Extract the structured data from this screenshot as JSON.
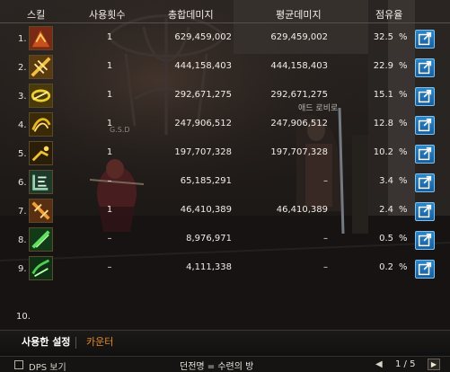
{
  "header": {
    "skill": "스킬",
    "uses": "사용횟수",
    "total": "총합데미지",
    "avg": "평균데미지",
    "share": "점유율"
  },
  "rows": [
    {
      "index": "1.",
      "icon": "skill-icon-1",
      "uses": "1",
      "total": "629,459,002",
      "avg": "629,459,002",
      "share": "32.5",
      "pct": "%"
    },
    {
      "index": "2.",
      "icon": "skill-icon-2",
      "uses": "1",
      "total": "444,158,403",
      "avg": "444,158,403",
      "share": "22.9",
      "pct": "%"
    },
    {
      "index": "3.",
      "icon": "skill-icon-3",
      "uses": "1",
      "total": "292,671,275",
      "avg": "292,671,275",
      "share": "15.1",
      "pct": "%"
    },
    {
      "index": "4.",
      "icon": "skill-icon-4",
      "uses": "1",
      "total": "247,906,512",
      "avg": "247,906,512",
      "share": "12.8",
      "pct": "%"
    },
    {
      "index": "5.",
      "icon": "skill-icon-5",
      "uses": "1",
      "total": "197,707,328",
      "avg": "197,707,328",
      "share": "10.2",
      "pct": "%"
    },
    {
      "index": "6.",
      "icon": "skill-icon-6",
      "uses": "–",
      "total": "65,185,291",
      "avg": "–",
      "share": "3.4",
      "pct": "%"
    },
    {
      "index": "7.",
      "icon": "skill-icon-7",
      "uses": "1",
      "total": "46,410,389",
      "avg": "46,410,389",
      "share": "2.4",
      "pct": "%"
    },
    {
      "index": "8.",
      "icon": "skill-icon-8",
      "uses": "–",
      "total": "8,976,971",
      "avg": "–",
      "share": "0.5",
      "pct": "%"
    },
    {
      "index": "9.",
      "icon": "skill-icon-9",
      "uses": "–",
      "total": "4,111,338",
      "avg": "–",
      "share": "0.2",
      "pct": "%"
    },
    {
      "index": "10.",
      "icon": "",
      "uses": "",
      "total": "",
      "avg": "",
      "share": "",
      "pct": ""
    }
  ],
  "tabs": {
    "settings": "사용한 설정",
    "counter": "카운터"
  },
  "footer": {
    "dps_label": "DPS 보기",
    "dungeon": "던전명 = 수련의 방",
    "prev": "◀",
    "page": "1 / 5",
    "next": "▶"
  },
  "scene": {
    "name_tag": "애드 로비로",
    "gsd_tag": "G.S.D"
  },
  "colors": {
    "accent_orange": "#e08a28",
    "detail_blue": "#2a86c8"
  }
}
